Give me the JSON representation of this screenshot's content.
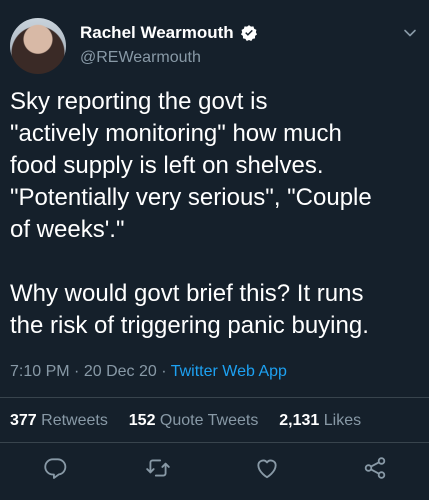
{
  "user": {
    "display_name": "Rachel Wearmouth",
    "handle": "@REWearmouth"
  },
  "tweet": {
    "text": "Sky reporting the govt is\n\"actively monitoring\" how much\nfood supply is left on shelves.\n\"Potentially very serious\", \"Couple\nof weeks'.\"\n\nWhy would govt brief this? It runs\nthe risk of triggering panic buying."
  },
  "meta": {
    "time": "7:10 PM",
    "separator": "·",
    "date": "20 Dec 20",
    "source": "Twitter Web App"
  },
  "stats": {
    "retweets_count": "377",
    "retweets_label": "Retweets",
    "quotes_count": "152",
    "quotes_label": "Quote Tweets",
    "likes_count": "2,131",
    "likes_label": "Likes"
  },
  "icons": {
    "reply": "reply-icon",
    "retweet": "retweet-icon",
    "like": "heart-icon",
    "share": "share-icon",
    "verified": "verified-badge-icon",
    "more": "chevron-down-icon"
  },
  "colors": {
    "background": "#15202b",
    "text": "#ffffff",
    "muted": "#8899a6",
    "link": "#1da1f2",
    "divider": "#38444d"
  }
}
